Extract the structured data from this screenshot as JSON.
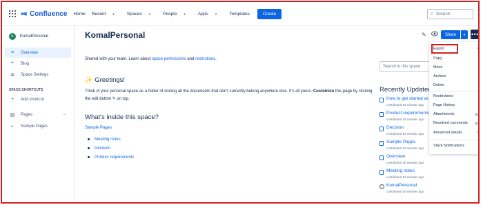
{
  "topnav": {
    "logo": "Confluence",
    "items": [
      "Home",
      "Recent",
      "Spaces",
      "People",
      "Apps",
      "Templates"
    ],
    "create": "Create",
    "search_placeholder": "Search"
  },
  "sidebar": {
    "space_name": "KomalPersonal",
    "space_initial": "K",
    "items": [
      "Overview",
      "Blog",
      "Space Settings"
    ],
    "shortcuts_heading": "SPACE SHORTCUTS",
    "add_shortcut": "Add shortcut",
    "pages": "Pages",
    "pages_more": "···",
    "sample_pages": "Sample Pages"
  },
  "main": {
    "title": "KomalPersonal",
    "share": "Share",
    "intro_prefix": "Shared with your team. Learn about ",
    "intro_link1": "space permissions",
    "intro_and": " and ",
    "intro_link2": "restrictions",
    "intro_suffix": ".",
    "greetings": "Greetings!",
    "para_a": "Think of your personal space as a folder of storing all the documents that don't currently belong anywhere else. It's all yours. ",
    "para_bold": "Customize",
    "para_b": " this page by clicking the edit button ",
    "para_c": " on top.",
    "whats_inside": "What's inside this space?",
    "sample_pages": "Sample Pages",
    "bullets": [
      "Meeting notes",
      "Decision",
      "Product requirements"
    ],
    "search_placeholder": "Search in this space",
    "recently_updated": "Recently Updated",
    "recent": [
      {
        "title": "How to get started wi",
        "sub": "contributed 16 minutes ago"
      },
      {
        "title": "Product requirements",
        "sub": "contributed 16 minutes ago"
      },
      {
        "title": "Decision",
        "sub": "contributed 16 minutes ago"
      },
      {
        "title": "Sample Pages",
        "sub": "contributed 16 minutes ago"
      },
      {
        "title": "Overview",
        "sub": "contributed 16 minutes ago"
      },
      {
        "title": "Meeting notes",
        "sub": "contributed 16 minutes ago"
      },
      {
        "title": "KomalPersonal",
        "sub": "contributed 16 minutes ago"
      }
    ]
  },
  "menu": {
    "export": "Export",
    "copy": "Copy",
    "move": "Move",
    "archive": "Archive",
    "delete": "Delete",
    "restrictions": "Restrictions",
    "page_history": "Page History",
    "attachments": "Attachments",
    "resolved_comments": "Resolved comments",
    "advanced_details": "Advanced details",
    "slack_notifications": "Slack Notifications"
  },
  "colors": {
    "accent": "#0c66e4",
    "highlight_border": "#d21f1f",
    "avatar": "#1f845a"
  }
}
